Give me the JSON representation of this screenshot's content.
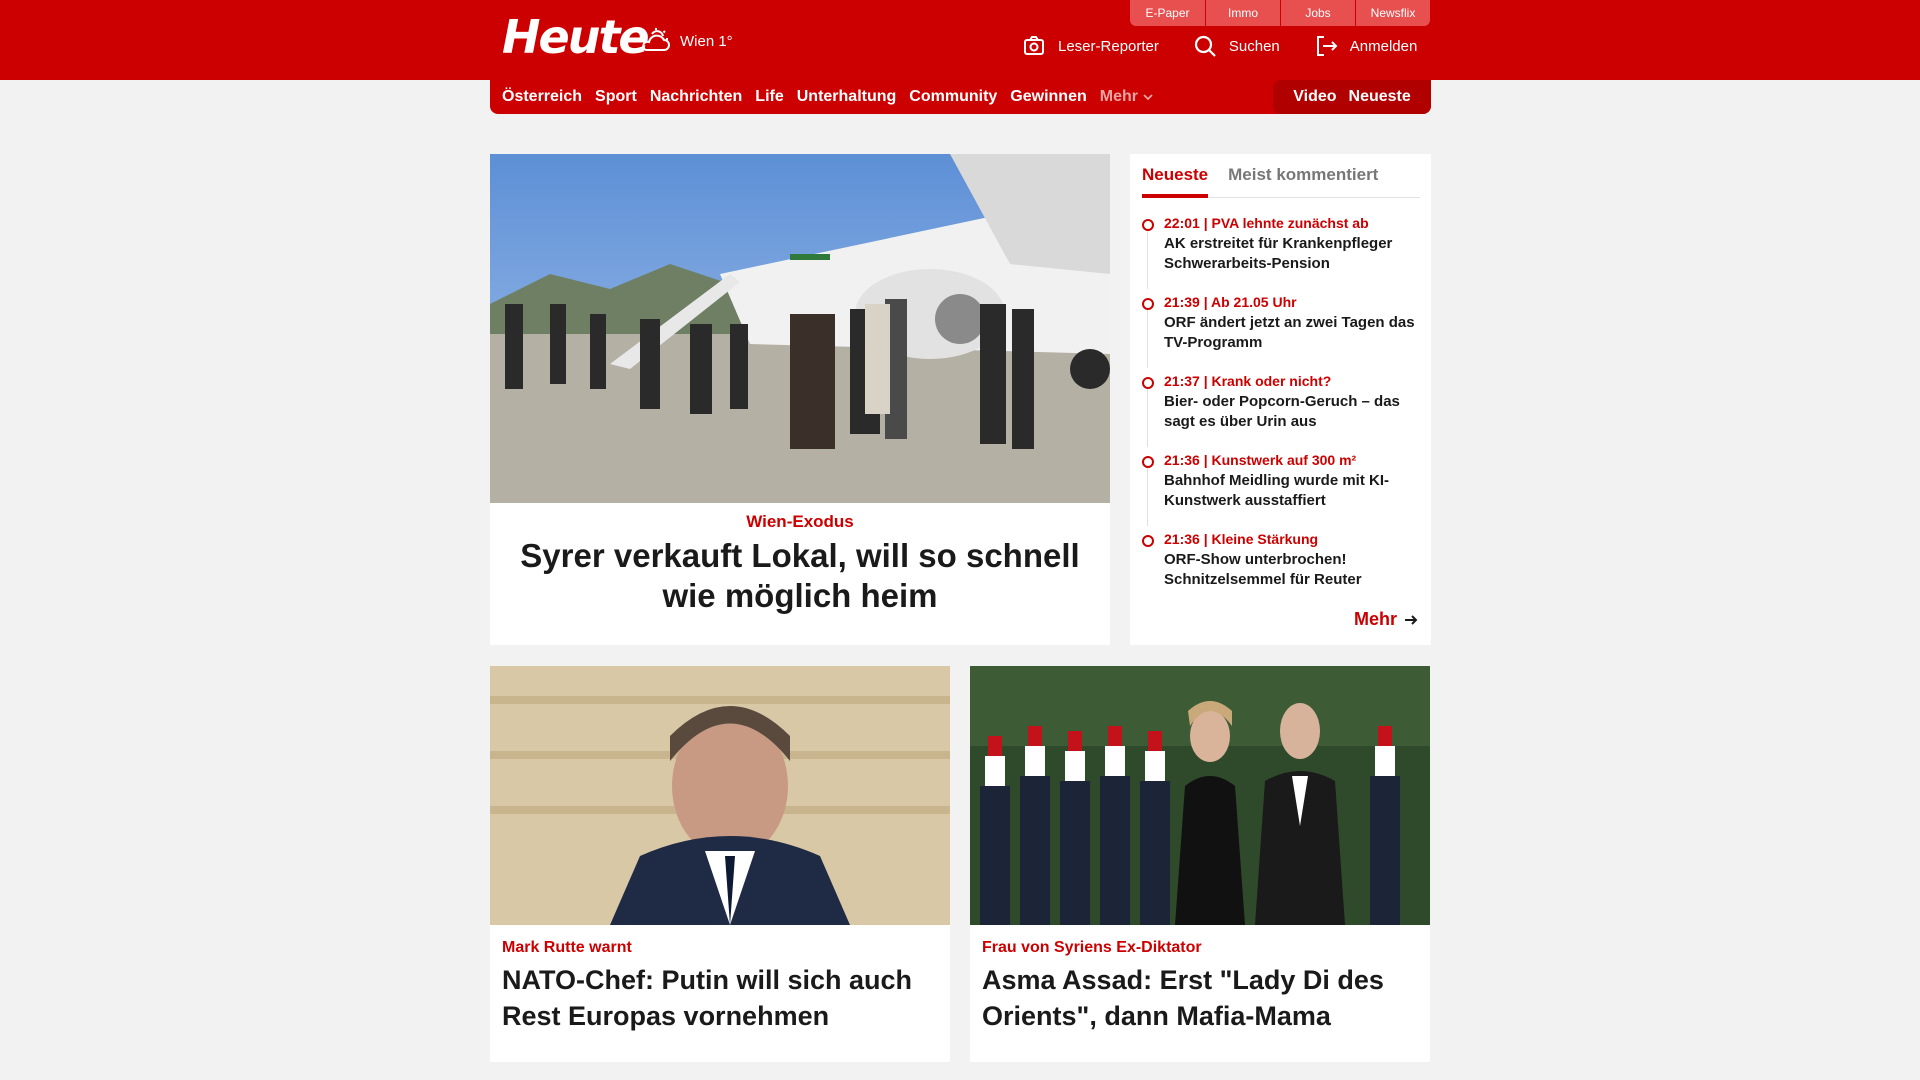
{
  "header": {
    "logo": "Heute",
    "weather": {
      "icon": "cloud-sun-icon",
      "text": "Wien 1°"
    },
    "top_tabs": [
      "E-Paper",
      "Immo",
      "Jobs",
      "Newsflix"
    ],
    "actions": [
      {
        "label": "Leser-Reporter",
        "icon": "camera-icon"
      },
      {
        "label": "Suchen",
        "icon": "search-icon"
      },
      {
        "label": "Anmelden",
        "icon": "login-icon"
      }
    ],
    "brand_color": "#cc0000"
  },
  "nav": {
    "items": [
      "Österreich",
      "Sport",
      "Nachrichten",
      "Life",
      "Unterhaltung",
      "Community",
      "Gewinnen"
    ],
    "more": "Mehr",
    "right": [
      "Video",
      "Neueste"
    ]
  },
  "hero": {
    "kicker": "Wien-Exodus",
    "title": "Syrer verkauft Lokal, will so schnell wie möglich heim"
  },
  "sidebar": {
    "tabs": [
      "Neueste",
      "Meist kommentiert"
    ],
    "items": [
      {
        "meta": "22:01 | PVA lehnte zunächst ab",
        "headline": "AK erstreitet für Krankenpfleger Schwerarbeits-Pension"
      },
      {
        "meta": "21:39 | Ab 21.05 Uhr",
        "headline": "ORF ändert jetzt an zwei Tagen das TV-Programm"
      },
      {
        "meta": "21:37 | Krank oder nicht?",
        "headline": "Bier- oder Popcorn-Geruch – das sagt es über Urin aus"
      },
      {
        "meta": "21:36 | Kunstwerk auf 300 m²",
        "headline": "Bahnhof Meidling wurde mit KI-Kunstwerk ausstaffiert"
      },
      {
        "meta": "21:36 | Kleine Stärkung",
        "headline": "ORF-Show unterbrochen! Schnitzelsemmel für Reuter"
      }
    ],
    "more": "Mehr"
  },
  "cards": [
    {
      "kicker": "Mark Rutte warnt",
      "title": "NATO-Chef: Putin will sich auch Rest Europas vornehmen"
    },
    {
      "kicker": "Frau von Syriens Ex-Diktator",
      "title": "Asma Assad: Erst \"Lady Di des Orients\", dann Mafia-Mama"
    }
  ]
}
